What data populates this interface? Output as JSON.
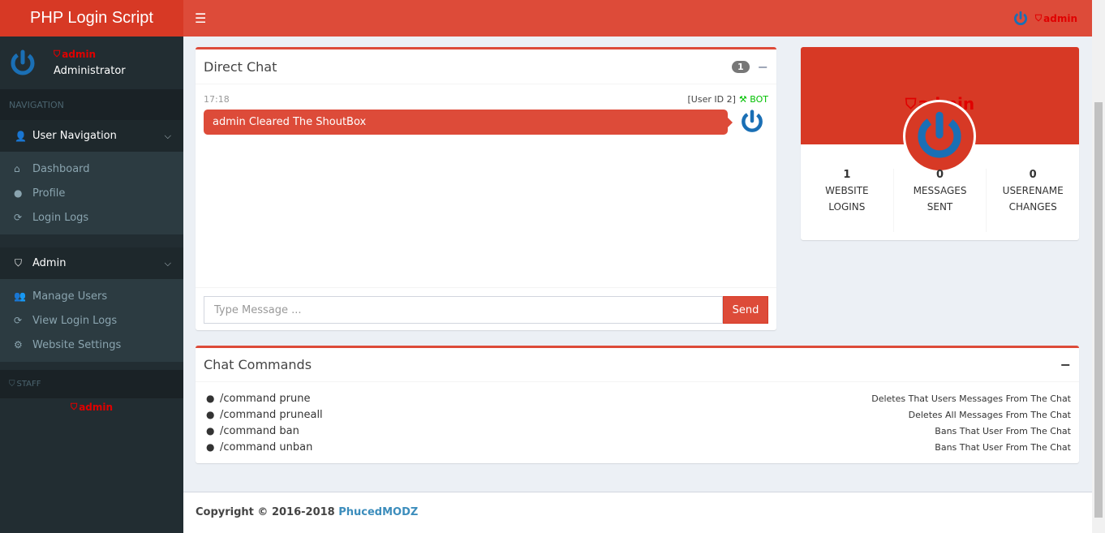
{
  "app": {
    "title": "PHP Login Script"
  },
  "user": {
    "rank_label": "admin",
    "role": "Administrator"
  },
  "sidebar": {
    "navigation_header": "NAVIGATION",
    "user_nav": {
      "label": "User Navigation",
      "items": [
        {
          "label": "Dashboard",
          "icon": "home-icon"
        },
        {
          "label": "Profile",
          "icon": "user-icon"
        },
        {
          "label": "Login Logs",
          "icon": "refresh-icon"
        }
      ]
    },
    "admin_nav": {
      "label": "Admin",
      "items": [
        {
          "label": "Manage Users",
          "icon": "users-icon"
        },
        {
          "label": "View Login Logs",
          "icon": "refresh-icon"
        },
        {
          "label": "Website Settings",
          "icon": "gear-icon"
        }
      ]
    },
    "staff_header": "STAFF",
    "staff_member": "admin"
  },
  "topbar": {
    "user_label": "admin"
  },
  "chat": {
    "title": "Direct Chat",
    "badge": "1",
    "message": {
      "time": "17:18",
      "user": "[User ID 2]",
      "bot": "BOT",
      "text": "admin Cleared The ShoutBox"
    },
    "input_placeholder": "Type Message ...",
    "send_label": "Send"
  },
  "profile": {
    "rank_label": "admin",
    "stats": [
      {
        "value": "1",
        "line1": "WEBSITE",
        "line2": "LOGINS"
      },
      {
        "value": "0",
        "line1": "MESSAGES",
        "line2": "SENT"
      },
      {
        "value": "0",
        "line1": "USERENAME",
        "line2": "CHANGES"
      }
    ]
  },
  "commands": {
    "title": "Chat Commands",
    "items": [
      {
        "name": "/command prune",
        "desc": "Deletes That Users Messages From The Chat"
      },
      {
        "name": "/command pruneall",
        "desc": "Deletes All Messages From The Chat"
      },
      {
        "name": "/command ban",
        "desc": "Bans That User From The Chat"
      },
      {
        "name": "/command unban",
        "desc": "Bans That User From The Chat"
      }
    ]
  },
  "footer": {
    "copyright": "Copyright © 2016-2018",
    "brand": "PhucedMODZ"
  },
  "colors": {
    "primary": "#dd4b39",
    "dark": "#d73925",
    "sidebar": "#222d32",
    "link": "#3c8dbc",
    "bot": "#00c000",
    "power": "#1a6fb5"
  }
}
